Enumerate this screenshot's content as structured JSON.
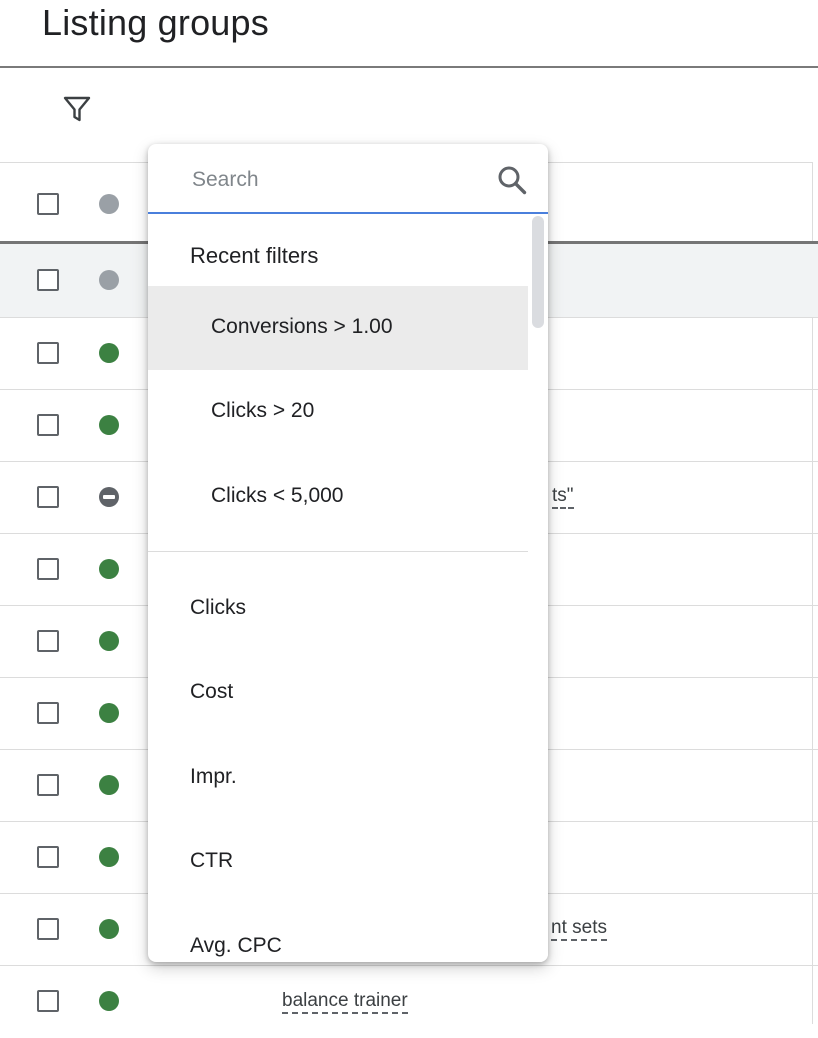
{
  "header": {
    "title": "Listing groups"
  },
  "toolbar": {
    "filter_icon": "filter-icon"
  },
  "table": {
    "rows": [
      {
        "status": "grey",
        "text": ""
      },
      {
        "status": "grey",
        "text": ""
      },
      {
        "status": "green",
        "text": ""
      },
      {
        "status": "green",
        "text": ""
      },
      {
        "status": "paused",
        "text": "ts\""
      },
      {
        "status": "green",
        "text": ""
      },
      {
        "status": "green",
        "text": ""
      },
      {
        "status": "green",
        "text": ""
      },
      {
        "status": "green",
        "text": ""
      },
      {
        "status": "green",
        "text": ""
      },
      {
        "status": "green",
        "text": "nt sets"
      },
      {
        "status": "green",
        "text": "balance trainer"
      }
    ]
  },
  "dropdown": {
    "search": {
      "placeholder": "Search",
      "value": ""
    },
    "recent_title": "Recent filters",
    "recent": [
      "Conversions > 1.00",
      "Clicks > 20",
      "Clicks < 5,000"
    ],
    "metrics": [
      "Clicks",
      "Cost",
      "Impr.",
      "CTR",
      "Avg. CPC"
    ]
  },
  "colors": {
    "accent_blue": "#4a7fdc",
    "status_green": "#3c8142",
    "status_grey": "#9aa0a6",
    "highlight": "#ebebeb"
  }
}
